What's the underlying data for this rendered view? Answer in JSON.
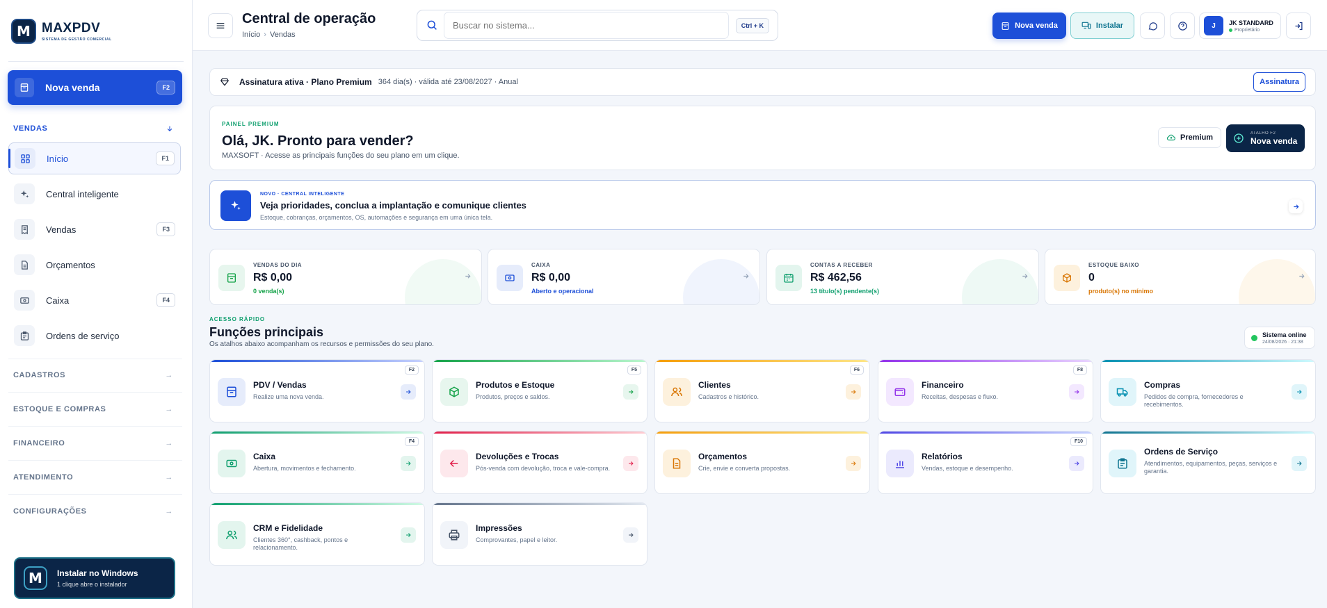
{
  "brand": {
    "name": "MAXPDV",
    "tagline": "SISTEMA DE GESTÃO COMERCIAL",
    "logo_letter": "M"
  },
  "sidebar": {
    "cta": {
      "label": "Nova venda",
      "shortcut": "F2"
    },
    "section_vendas": "VENDAS",
    "items": [
      {
        "label": "Início",
        "shortcut": "F1"
      },
      {
        "label": "Central inteligente",
        "shortcut": ""
      },
      {
        "label": "Vendas",
        "shortcut": "F3"
      },
      {
        "label": "Orçamentos",
        "shortcut": ""
      },
      {
        "label": "Caixa",
        "shortcut": "F4"
      },
      {
        "label": "Ordens de serviço",
        "shortcut": ""
      }
    ],
    "sections": [
      "CADASTROS",
      "ESTOQUE E COMPRAS",
      "FINANCEIRO",
      "ATENDIMENTO",
      "CONFIGURAÇÕES"
    ],
    "install": {
      "title": "Instalar no Windows",
      "subtitle": "1 clique abre o instalador"
    }
  },
  "header": {
    "title": "Central de operação",
    "breadcrumb": [
      "Início",
      "Vendas"
    ],
    "search_placeholder": "Buscar no sistema...",
    "search_shortcut": "Ctrl + K",
    "new_sale": "Nova venda",
    "install": "Instalar",
    "user": {
      "initial": "J",
      "name": "JK STANDARD",
      "role": "Proprietário"
    }
  },
  "subscription": {
    "title": "Assinatura ativa · Plano Premium",
    "detail": "364 dia(s) · válida até 23/08/2027 · Anual",
    "button": "Assinatura"
  },
  "hero": {
    "kicker": "PAINEL PREMIUM",
    "title": "Olá, JK. Pronto para vender?",
    "subtitle": "MAXSOFT · Acesse as principais funções do seu plano em um clique.",
    "premium": "Premium",
    "shortcut_label": "ATALHO F2",
    "cta": "Nova venda"
  },
  "intel": {
    "kicker": "NOVO · CENTRAL INTELIGENTE",
    "title": "Veja prioridades, conclua a implantação e comunique clientes",
    "subtitle": "Estoque, cobranças, orçamentos, OS, automações e segurança em uma única tela."
  },
  "kpis": [
    {
      "label": "VENDAS DO DIA",
      "value": "R$ 0,00",
      "sub": "0 venda(s)",
      "color": "#16a34a"
    },
    {
      "label": "CAIXA",
      "value": "R$ 0,00",
      "sub": "Aberto e operacional",
      "color": "#1d4fd8"
    },
    {
      "label": "CONTAS A RECEBER",
      "value": "R$ 462,56",
      "sub": "13 título(s) pendente(s)",
      "color": "#0f9f6e"
    },
    {
      "label": "ESTOQUE BAIXO",
      "value": "0",
      "sub": "produto(s) no mínimo",
      "color": "#d97706"
    }
  ],
  "quick": {
    "kicker": "ACESSO RÁPIDO",
    "title": "Funções principais",
    "subtitle": "Os atalhos abaixo acompanham os recursos e permissões do seu plano.",
    "status_title": "Sistema online",
    "status_time": "24/08/2026 · 21:38",
    "tiles": [
      {
        "title": "PDV / Vendas",
        "desc": "Realize uma nova venda.",
        "shortcut": "F2",
        "color": "#1d4fd8"
      },
      {
        "title": "Produtos e Estoque",
        "desc": "Produtos, preços e saldos.",
        "shortcut": "F5",
        "color": "#16a34a"
      },
      {
        "title": "Clientes",
        "desc": "Cadastros e histórico.",
        "shortcut": "F6",
        "color": "#f59e0b"
      },
      {
        "title": "Financeiro",
        "desc": "Receitas, despesas e fluxo.",
        "shortcut": "F8",
        "color": "#9333ea"
      },
      {
        "title": "Compras",
        "desc": "Pedidos de compra, fornecedores e recebimentos.",
        "shortcut": "",
        "color": "#0891b2"
      },
      {
        "title": "Caixa",
        "desc": "Abertura, movimentos e fechamento.",
        "shortcut": "F4",
        "color": "#0f9f6e"
      },
      {
        "title": "Devoluções e Trocas",
        "desc": "Pós-venda com devolução, troca e vale-compra.",
        "shortcut": "",
        "color": "#e11d48"
      },
      {
        "title": "Orçamentos",
        "desc": "Crie, envie e converta propostas.",
        "shortcut": "",
        "color": "#f59e0b"
      },
      {
        "title": "Relatórios",
        "desc": "Vendas, estoque e desempenho.",
        "shortcut": "F10",
        "color": "#4f46e5"
      },
      {
        "title": "Ordens de Serviço",
        "desc": "Atendimentos, equipamentos, peças, serviços e garantia.",
        "shortcut": "",
        "color": "#0e7490"
      },
      {
        "title": "CRM e Fidelidade",
        "desc": "Clientes 360°, cashback, pontos e relacionamento.",
        "shortcut": "",
        "color": "#0f9f6e"
      },
      {
        "title": "Impressões",
        "desc": "Comprovantes, papel e leitor.",
        "shortcut": "",
        "color": "#475569"
      }
    ]
  }
}
